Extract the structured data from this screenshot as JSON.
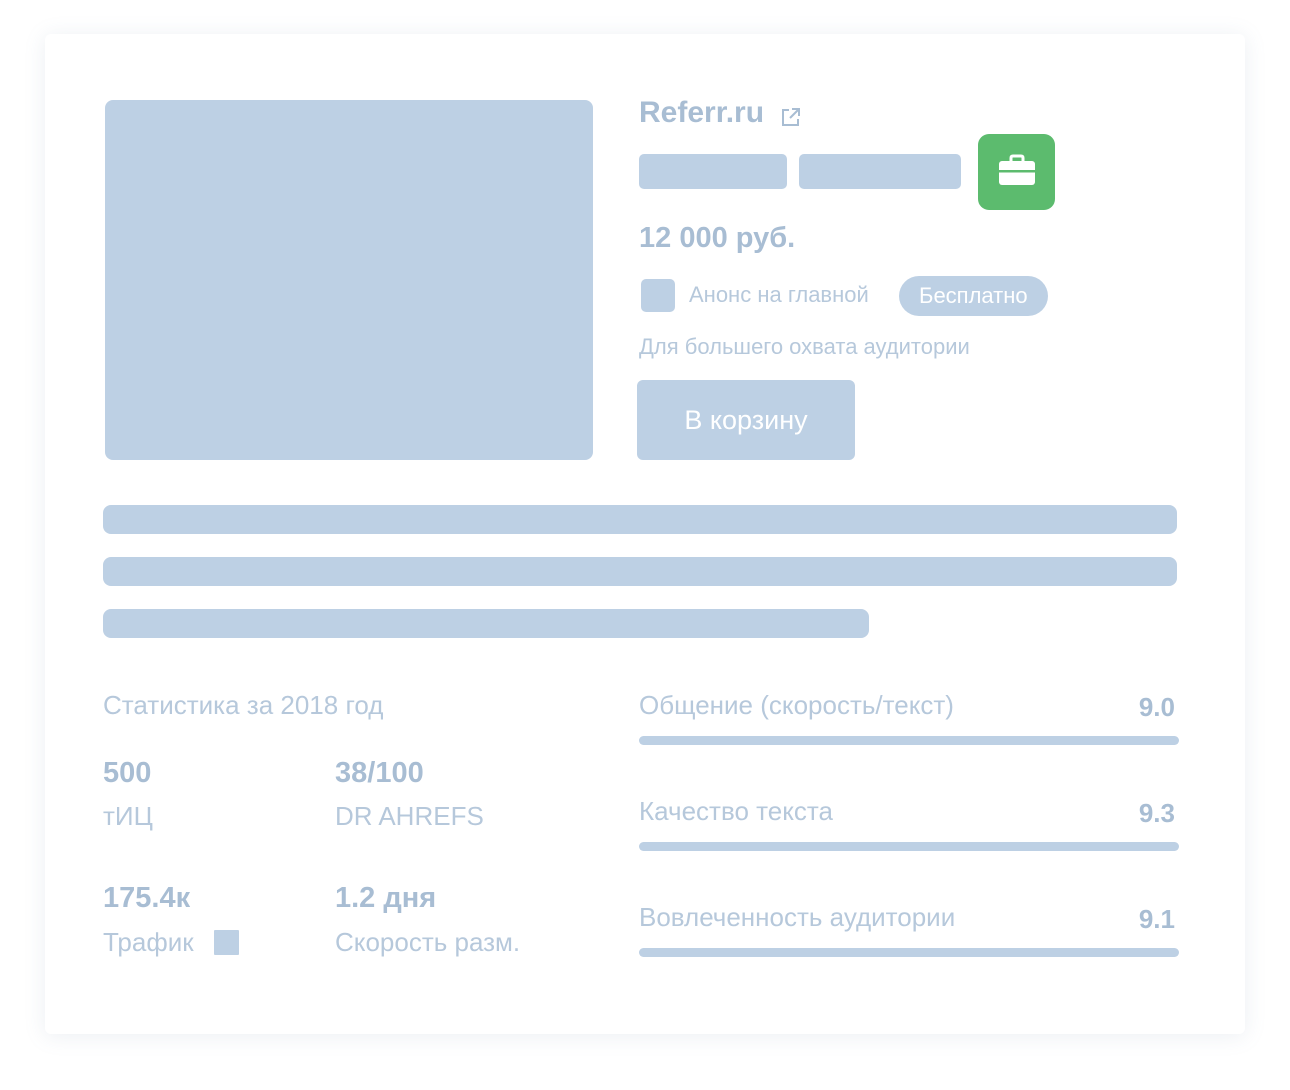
{
  "listing": {
    "site_name": "Referr.ru",
    "price": "12 000 руб.",
    "announce_label": "Анонс на главной",
    "announce_badge": "Бесплатно",
    "announce_checked": false,
    "reach_note": "Для большего охвата аудитории",
    "cart_button_label": "В корзину",
    "briefcase_button_color": "#5cbb6e"
  },
  "stats": {
    "title": "Статистика за 2018 год",
    "items": [
      {
        "value": "500",
        "label": "тИЦ"
      },
      {
        "value": "38/100",
        "label": "DR AHREFS"
      },
      {
        "value": "175.4к",
        "label": "Трафик"
      },
      {
        "value": "1.2 дня",
        "label": "Скорость разм."
      }
    ]
  },
  "ratings": [
    {
      "label": "Общение (скорость/текст)",
      "value": "9.0"
    },
    {
      "label": "Качество текста",
      "value": "9.3"
    },
    {
      "label": "Вовлеченность аудитории",
      "value": "9.1"
    }
  ],
  "colors": {
    "placeholder": "#bdd0e4",
    "text_primary": "#a8bdd3",
    "text_secondary": "#b6c8db",
    "accent_green": "#5cbb6e"
  }
}
